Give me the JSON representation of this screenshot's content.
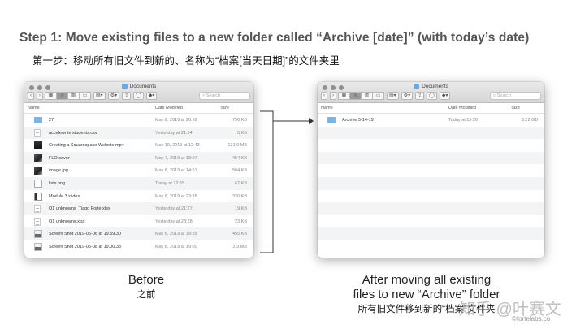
{
  "header": {
    "title": "Step 1: Move existing files to a new folder called “Archive [date]” (with today’s date)",
    "subtitle": "第一步：移动所有旧文件到新的、名称为“档案[当天日期]”的文件夹里"
  },
  "finder": {
    "window_title": "Documents",
    "search_placeholder": "Search",
    "columns": {
      "name": "Name",
      "date": "Date Modified",
      "size": "Size"
    }
  },
  "before_window": {
    "files": [
      {
        "icon": "folder",
        "name": "27",
        "date": "May 8, 2019 at 20:52",
        "size": "796 KB"
      },
      {
        "icon": "doc",
        "name": "accelewrite students.csv",
        "date": "Yesterday at 21:54",
        "size": "5 KB"
      },
      {
        "icon": "mov",
        "name": "Creating a Squarespace Website.mp4",
        "date": "May 10, 2019 at 12:43",
        "size": "121.9 MB"
      },
      {
        "icon": "img",
        "name": "FLO cover",
        "date": "May 7, 2019 at 18:07",
        "size": "454 KB"
      },
      {
        "icon": "img",
        "name": "image.jpg",
        "date": "May 8, 2019 at 14:51",
        "size": "504 KB"
      },
      {
        "icon": "png",
        "name": "lists.png",
        "date": "Today at 12:55",
        "size": "67 KB"
      },
      {
        "icon": "slides",
        "name": "Module 3 slides",
        "date": "May 8, 2019 at 23:38",
        "size": "320 KB"
      },
      {
        "icon": "doc",
        "name": "Q1 unknowns_Tiago Forte.xlsx",
        "date": "Yesterday at 21:27",
        "size": "19 KB"
      },
      {
        "icon": "doc",
        "name": "Q1 unknowns.xlsx",
        "date": "Yesterday at 23:28",
        "size": "23 KB"
      },
      {
        "icon": "shot",
        "name": "Screen Shot 2019-05-06 at 19.59.30",
        "date": "May 6, 2019 at 19:59",
        "size": "455 KB"
      },
      {
        "icon": "shot",
        "name": "Screen Shot 2019-05-08 at 19.00.38",
        "date": "May 8, 2019 at 19:00",
        "size": "2.3 MB"
      }
    ]
  },
  "after_window": {
    "files": [
      {
        "icon": "folder",
        "name": "Archive 5-14-19",
        "date": "Today at 15:20",
        "size": "3.22 GB"
      }
    ]
  },
  "captions": {
    "before_en": "Before",
    "before_cn": "之前",
    "after_en_line1": "After moving all existing",
    "after_en_line2": "files to new “Archive” folder",
    "after_cn": "所有旧文件移到新的“档案”文件夹"
  },
  "watermarks": {
    "zhihu": "知乎 @叶赛文",
    "fortelabs": "©fortelabs.co"
  },
  "colors": {
    "folder": "#7ab3e6",
    "arrow": "#333333"
  }
}
